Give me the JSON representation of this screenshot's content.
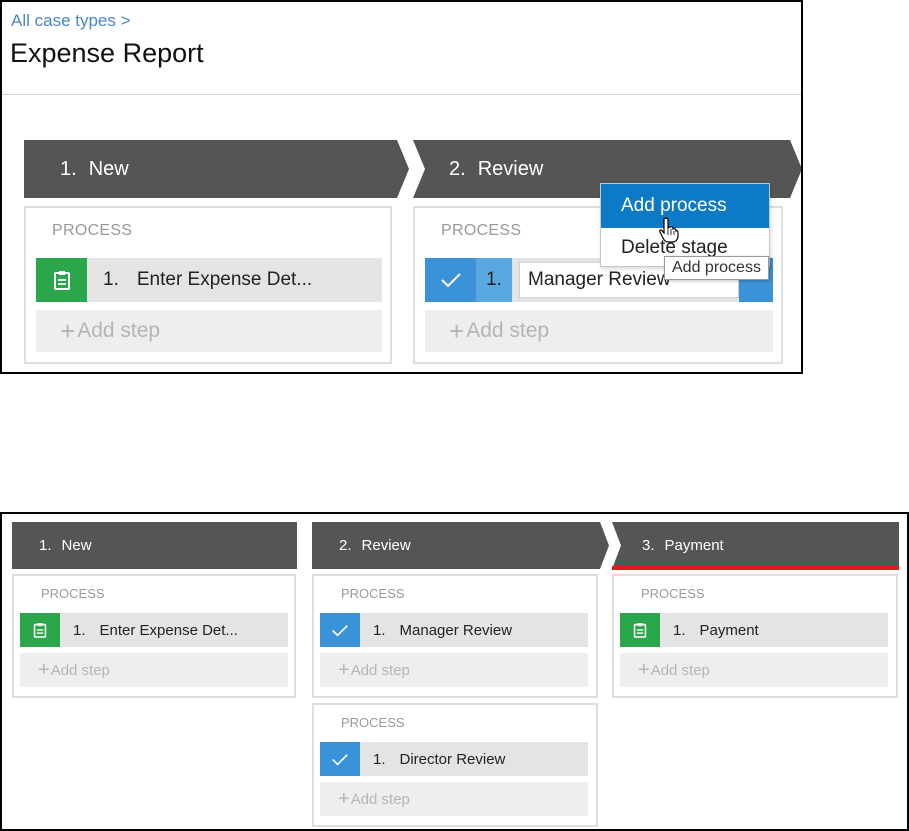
{
  "panel1": {
    "breadcrumb": "All case types >",
    "title": "Expense Report",
    "stages": [
      {
        "number": "1.",
        "name": "New"
      },
      {
        "number": "2.",
        "name": "Review"
      }
    ],
    "process_label": "PROCESS",
    "stage1_step": {
      "number": "1.",
      "name": "Enter Expense Det..."
    },
    "stage2_step": {
      "number": "1.",
      "name": "Manager Review"
    },
    "add_step_label": "Add step",
    "context_menu": {
      "items": [
        "Add process",
        "Delete stage"
      ]
    },
    "tooltip": "Add process"
  },
  "panel2": {
    "stages": [
      {
        "number": "1.",
        "name": "New"
      },
      {
        "number": "2.",
        "name": "Review"
      },
      {
        "number": "3.",
        "name": "Payment"
      }
    ],
    "process_label": "PROCESS",
    "add_step_label": "Add step",
    "steps": {
      "new_p1": {
        "number": "1.",
        "name": "Enter Expense Det..."
      },
      "review_p1": {
        "number": "1.",
        "name": "Manager Review"
      },
      "review_p2": {
        "number": "1.",
        "name": "Director Review"
      },
      "payment_p1": {
        "number": "1.",
        "name": "Payment"
      }
    }
  },
  "colors": {
    "stage_bg": "#555555",
    "step_green": "#2aa74a",
    "step_blue": "#3a92d8",
    "menu_active": "#0c7ac7",
    "link": "#4a86c5",
    "stage_highlight": "#e21b1b"
  },
  "icons": {
    "assignment": "clipboard-icon",
    "approval": "checkmark-icon",
    "add": "plus-icon"
  }
}
